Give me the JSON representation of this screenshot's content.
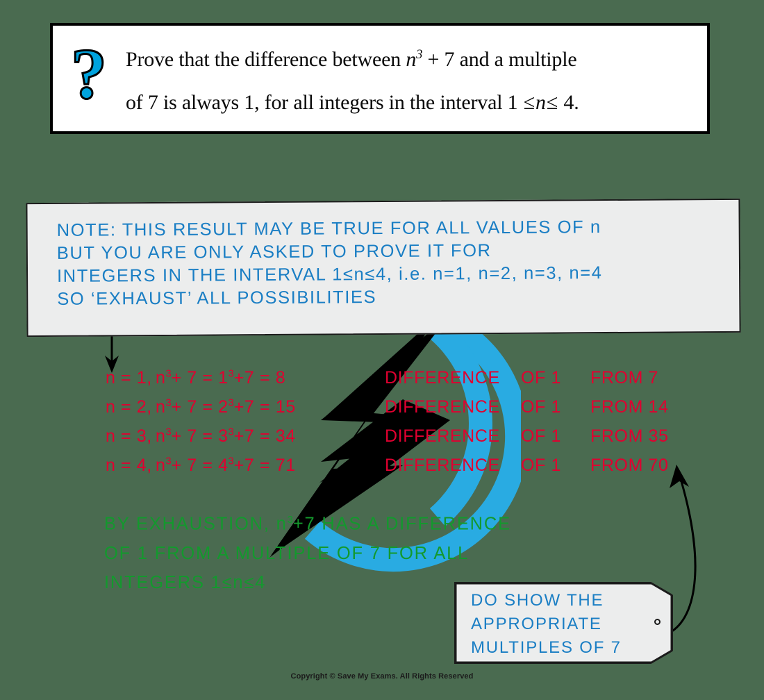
{
  "page": {
    "background_color": "#4a6b50",
    "footer": "Copyright © Save My Exams. All Rights Reserved"
  },
  "question": {
    "icon": "question-mark-icon",
    "icon_color": "#00A3DE",
    "line1_a": "Prove that the difference between ",
    "line1_var": "n",
    "line1_sup": "3",
    "line1_b": " + 7 and a multiple",
    "line2_a": "of 7 is always 1, for all integers in the interval 1 ",
    "line2_le1": "≤",
    "line2_var": "n",
    "line2_le2": "≤",
    "line2_b": " 4."
  },
  "note": {
    "color": "#1A7EC4",
    "lines": [
      "NOTE:  THIS   RESULT   MAY   BE   TRUE   FOR   ALL   VALUES   OF  n",
      "BUT   YOU   ARE   ONLY   ASKED   TO   PROVE   IT   FOR",
      "INTEGERS   IN   THE   INTERVAL   1≤n≤4,  i.e.   n=1,  n=2,  n=3,  n=4",
      "SO  ‘EXHAUST’  ALL  POSSIBILITIES"
    ]
  },
  "working": {
    "color": "#E00030",
    "rows": [
      {
        "n": "n = 1,",
        "expr_a": "n",
        "expr_sup": "3",
        "expr_b": "+ 7 = 1",
        "expr_sup2": "3",
        "expr_c": "+7 = 8",
        "diff": "DIFFERENCE",
        "of": "OF  1",
        "from": "FROM  7"
      },
      {
        "n": "n = 2,",
        "expr_a": "n",
        "expr_sup": "3",
        "expr_b": "+ 7 = 2",
        "expr_sup2": "3",
        "expr_c": "+7 = 15",
        "diff": "DIFFERENCE",
        "of": "OF  1",
        "from": "FROM  14"
      },
      {
        "n": "n = 3,",
        "expr_a": "n",
        "expr_sup": "3",
        "expr_b": "+ 7 = 3",
        "expr_sup2": "3",
        "expr_c": "+7 = 34",
        "diff": "DIFFERENCE",
        "of": "OF  1",
        "from": "FROM  35"
      },
      {
        "n": "n = 4,",
        "expr_a": "n",
        "expr_sup": "3",
        "expr_b": "+ 7 = 4",
        "expr_sup2": "3",
        "expr_c": "+7 = 71",
        "diff": "DIFFERENCE",
        "of": "OF  1",
        "from": "FROM  70"
      }
    ]
  },
  "conclusion": {
    "color": "#13992D",
    "line1_a": "BY  EXHAUSTION,  n",
    "line1_sup": "3",
    "line1_b": "+7  HAS  A  DIFFERENCE",
    "line2": "OF  1  FROM  A  MULTIPLE  OF  7  FOR  ALL",
    "line3": "INTEGERS  1≤n≤4"
  },
  "tag": {
    "color": "#1A7EC4",
    "lines": [
      "DO  SHOW  THE",
      "APPROPRIATE",
      "MULTIPLES  OF  7"
    ]
  },
  "watermark": {
    "name": "save-my-exams-lightning-logo",
    "bolt_color": "#000000",
    "ring_color": "#29ABE2"
  },
  "annotations": {
    "down_arrow": "arrow pointing from NOTE box down to working",
    "curved_arrow": "curved arrow from tag to FROM 70"
  }
}
